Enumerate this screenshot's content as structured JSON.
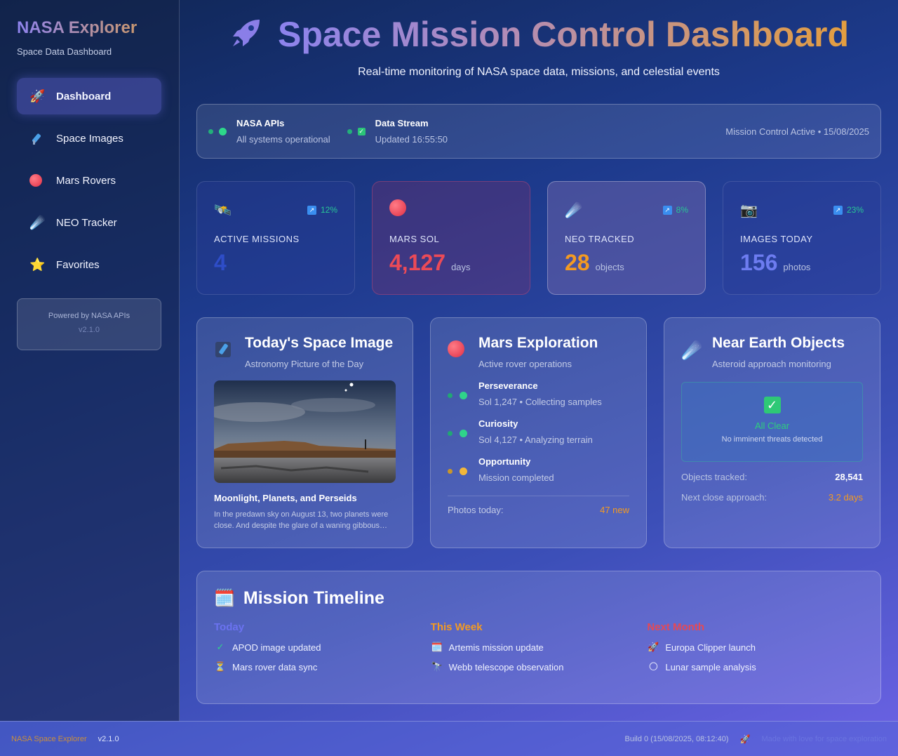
{
  "sidebar": {
    "title": "NASA Explorer",
    "subtitle": "Space Data Dashboard",
    "items": [
      {
        "label": "Dashboard",
        "icon": "rocket-icon",
        "active": true
      },
      {
        "label": "Space Images",
        "icon": "telescope-icon"
      },
      {
        "label": "Mars Rovers",
        "icon": "mars-planet-icon"
      },
      {
        "label": "NEO Tracker",
        "icon": "meteor-icon"
      },
      {
        "label": "Favorites",
        "icon": "star-icon"
      }
    ],
    "powered_by": "Powered by NASA APIs",
    "version": "v2.1.0"
  },
  "header": {
    "title": "Space Mission Control Dashboard",
    "subtitle": "Real-time monitoring of NASA space data, missions, and celestial events"
  },
  "status": {
    "apis": {
      "title": "NASA APIs",
      "detail": "All systems operational"
    },
    "stream": {
      "title": "Data Stream",
      "detail": "Updated 16:55:50"
    },
    "right": "Mission Control Active • 15/08/2025"
  },
  "stats": [
    {
      "label": "ACTIVE MISSIONS",
      "value": "4",
      "unit": "",
      "trend": "12%",
      "icon": "satellite-icon",
      "color": "#2e4dc8"
    },
    {
      "label": "MARS SOL",
      "value": "4,127",
      "unit": "days",
      "trend": "",
      "icon": "mars-planet-icon",
      "color": "#ec4a57"
    },
    {
      "label": "NEO TRACKED",
      "value": "28",
      "unit": "objects",
      "trend": "8%",
      "icon": "meteor-icon",
      "color": "#f39a22"
    },
    {
      "label": "IMAGES TODAY",
      "value": "156",
      "unit": "photos",
      "trend": "23%",
      "icon": "camera-icon",
      "color": "#6d7cf0"
    }
  ],
  "apod": {
    "title": "Today's Space Image",
    "subtitle": "Astronomy Picture of the Day",
    "image_title": "Moonlight, Planets, and Perseids",
    "image_desc": "In the predawn sky on August 13, two planets were close. And despite the glare of a waning gibbous…"
  },
  "mars": {
    "title": "Mars Exploration",
    "subtitle": "Active rover operations",
    "rovers": [
      {
        "name": "Perseverance",
        "status": "Sol 1,247 • Collecting samples",
        "color": "#2fd38a"
      },
      {
        "name": "Curiosity",
        "status": "Sol 4,127 • Analyzing terrain",
        "color": "#2fd38a"
      },
      {
        "name": "Opportunity",
        "status": "Mission completed",
        "color": "#f2b73a"
      }
    ],
    "footer_label": "Photos today:",
    "footer_value": "47 new"
  },
  "neo": {
    "title": "Near Earth Objects",
    "subtitle": "Asteroid approach monitoring",
    "clear_label": "All Clear",
    "clear_note": "No imminent threats detected",
    "tracked_label": "Objects tracked:",
    "tracked_value": "28,541",
    "approach_label": "Next close approach:",
    "approach_value": "3.2 days"
  },
  "timeline": {
    "title": "Mission Timeline",
    "columns": [
      {
        "title": "Today",
        "color": "#6b72f0",
        "items": [
          {
            "icon": "check-icon",
            "text": "APOD image updated"
          },
          {
            "icon": "hourglass-icon",
            "text": "Mars rover data sync"
          }
        ]
      },
      {
        "title": "This Week",
        "color": "#f39a22",
        "items": [
          {
            "icon": "calendar-icon",
            "text": "Artemis mission update"
          },
          {
            "icon": "telescope-icon",
            "text": "Webb telescope observation"
          }
        ]
      },
      {
        "title": "Next Month",
        "color": "#e44956",
        "items": [
          {
            "icon": "rocket-icon",
            "text": "Europa Clipper launch"
          },
          {
            "icon": "moon-icon",
            "text": "Lunar sample analysis"
          }
        ]
      }
    ]
  },
  "footer": {
    "brand": "NASA Space Explorer",
    "version": "v2.1.0",
    "build": "Build 0 (15/08/2025, 08:12:40)",
    "tagline": "Made with love for space exploration"
  }
}
